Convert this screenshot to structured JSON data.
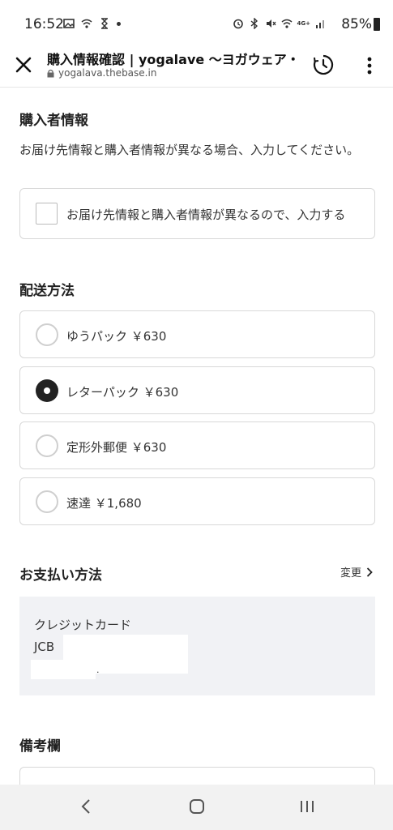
{
  "status_bar": {
    "time": "16:52",
    "battery": "85%",
    "icons": [
      "image-icon",
      "wifi-call-icon",
      "hourglass-icon",
      "dot",
      "alarm-icon",
      "bluetooth-icon",
      "mute-icon",
      "wifi-icon",
      "4g-icon",
      "signal-icon",
      "battery-icon"
    ],
    "network_label": "4G+"
  },
  "browser": {
    "title": "購入情報確認 | yogalave 〜ヨガウェア・",
    "url": "yogalava.thebase.in",
    "icons": [
      "close-icon",
      "lock-icon",
      "history-icon",
      "more-vert-icon"
    ]
  },
  "purchaser": {
    "heading": "購入者情報",
    "description": "お届け先情報と購入者情報が異なる場合、入力してください。",
    "checkbox_label": "お届け先情報と購入者情報が異なるので、入力する",
    "checked": false
  },
  "shipping": {
    "heading": "配送方法",
    "options": [
      {
        "label": "ゆうパック ￥630",
        "selected": false
      },
      {
        "label": "レターパック ￥630",
        "selected": true
      },
      {
        "label": "定形外郵便 ￥630",
        "selected": false
      },
      {
        "label": "速達 ￥1,680",
        "selected": false
      }
    ]
  },
  "payment": {
    "heading": "お支払い方法",
    "change_label": "変更",
    "method": "クレジットカード",
    "brand": "JCB",
    "trailing_mark": "."
  },
  "memo": {
    "heading": "備考欄"
  },
  "nav": {
    "icons": [
      "back-icon",
      "home-icon",
      "recents-icon"
    ]
  },
  "colors": {
    "accent": "#222222",
    "payment_bg": "#f1f2f5",
    "border": "#d8d8d8"
  }
}
